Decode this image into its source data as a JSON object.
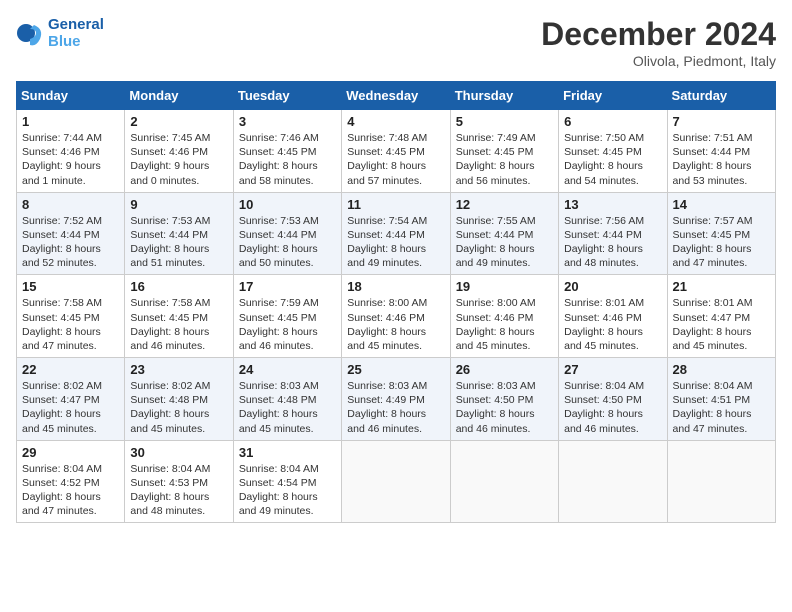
{
  "header": {
    "logo_line1": "General",
    "logo_line2": "Blue",
    "month": "December 2024",
    "location": "Olivola, Piedmont, Italy"
  },
  "weekdays": [
    "Sunday",
    "Monday",
    "Tuesday",
    "Wednesday",
    "Thursday",
    "Friday",
    "Saturday"
  ],
  "weeks": [
    [
      {
        "day": "1",
        "sunrise": "7:44 AM",
        "sunset": "4:46 PM",
        "daylight": "9 hours and 1 minute."
      },
      {
        "day": "2",
        "sunrise": "7:45 AM",
        "sunset": "4:46 PM",
        "daylight": "9 hours and 0 minutes."
      },
      {
        "day": "3",
        "sunrise": "7:46 AM",
        "sunset": "4:45 PM",
        "daylight": "8 hours and 58 minutes."
      },
      {
        "day": "4",
        "sunrise": "7:48 AM",
        "sunset": "4:45 PM",
        "daylight": "8 hours and 57 minutes."
      },
      {
        "day": "5",
        "sunrise": "7:49 AM",
        "sunset": "4:45 PM",
        "daylight": "8 hours and 56 minutes."
      },
      {
        "day": "6",
        "sunrise": "7:50 AM",
        "sunset": "4:45 PM",
        "daylight": "8 hours and 54 minutes."
      },
      {
        "day": "7",
        "sunrise": "7:51 AM",
        "sunset": "4:44 PM",
        "daylight": "8 hours and 53 minutes."
      }
    ],
    [
      {
        "day": "8",
        "sunrise": "7:52 AM",
        "sunset": "4:44 PM",
        "daylight": "8 hours and 52 minutes."
      },
      {
        "day": "9",
        "sunrise": "7:53 AM",
        "sunset": "4:44 PM",
        "daylight": "8 hours and 51 minutes."
      },
      {
        "day": "10",
        "sunrise": "7:53 AM",
        "sunset": "4:44 PM",
        "daylight": "8 hours and 50 minutes."
      },
      {
        "day": "11",
        "sunrise": "7:54 AM",
        "sunset": "4:44 PM",
        "daylight": "8 hours and 49 minutes."
      },
      {
        "day": "12",
        "sunrise": "7:55 AM",
        "sunset": "4:44 PM",
        "daylight": "8 hours and 49 minutes."
      },
      {
        "day": "13",
        "sunrise": "7:56 AM",
        "sunset": "4:44 PM",
        "daylight": "8 hours and 48 minutes."
      },
      {
        "day": "14",
        "sunrise": "7:57 AM",
        "sunset": "4:45 PM",
        "daylight": "8 hours and 47 minutes."
      }
    ],
    [
      {
        "day": "15",
        "sunrise": "7:58 AM",
        "sunset": "4:45 PM",
        "daylight": "8 hours and 47 minutes."
      },
      {
        "day": "16",
        "sunrise": "7:58 AM",
        "sunset": "4:45 PM",
        "daylight": "8 hours and 46 minutes."
      },
      {
        "day": "17",
        "sunrise": "7:59 AM",
        "sunset": "4:45 PM",
        "daylight": "8 hours and 46 minutes."
      },
      {
        "day": "18",
        "sunrise": "8:00 AM",
        "sunset": "4:46 PM",
        "daylight": "8 hours and 45 minutes."
      },
      {
        "day": "19",
        "sunrise": "8:00 AM",
        "sunset": "4:46 PM",
        "daylight": "8 hours and 45 minutes."
      },
      {
        "day": "20",
        "sunrise": "8:01 AM",
        "sunset": "4:46 PM",
        "daylight": "8 hours and 45 minutes."
      },
      {
        "day": "21",
        "sunrise": "8:01 AM",
        "sunset": "4:47 PM",
        "daylight": "8 hours and 45 minutes."
      }
    ],
    [
      {
        "day": "22",
        "sunrise": "8:02 AM",
        "sunset": "4:47 PM",
        "daylight": "8 hours and 45 minutes."
      },
      {
        "day": "23",
        "sunrise": "8:02 AM",
        "sunset": "4:48 PM",
        "daylight": "8 hours and 45 minutes."
      },
      {
        "day": "24",
        "sunrise": "8:03 AM",
        "sunset": "4:48 PM",
        "daylight": "8 hours and 45 minutes."
      },
      {
        "day": "25",
        "sunrise": "8:03 AM",
        "sunset": "4:49 PM",
        "daylight": "8 hours and 46 minutes."
      },
      {
        "day": "26",
        "sunrise": "8:03 AM",
        "sunset": "4:50 PM",
        "daylight": "8 hours and 46 minutes."
      },
      {
        "day": "27",
        "sunrise": "8:04 AM",
        "sunset": "4:50 PM",
        "daylight": "8 hours and 46 minutes."
      },
      {
        "day": "28",
        "sunrise": "8:04 AM",
        "sunset": "4:51 PM",
        "daylight": "8 hours and 47 minutes."
      }
    ],
    [
      {
        "day": "29",
        "sunrise": "8:04 AM",
        "sunset": "4:52 PM",
        "daylight": "8 hours and 47 minutes."
      },
      {
        "day": "30",
        "sunrise": "8:04 AM",
        "sunset": "4:53 PM",
        "daylight": "8 hours and 48 minutes."
      },
      {
        "day": "31",
        "sunrise": "8:04 AM",
        "sunset": "4:54 PM",
        "daylight": "8 hours and 49 minutes."
      },
      null,
      null,
      null,
      null
    ]
  ]
}
